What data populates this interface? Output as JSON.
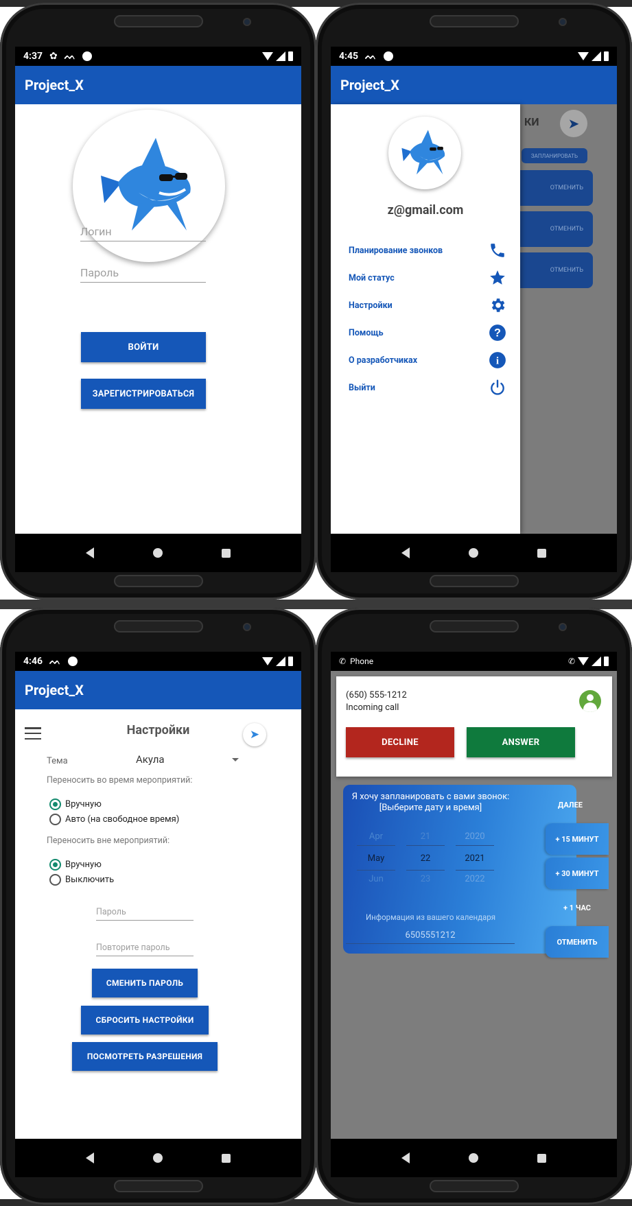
{
  "screens": {
    "login": {
      "time": "4:37",
      "app_title": "Project_X",
      "login_placeholder": "Логин",
      "password_placeholder": "Пароль",
      "login_button": "ВОЙТИ",
      "register_button": "ЗАРЕГИСТРИРОВАТЬСЯ"
    },
    "drawer": {
      "time": "4:45",
      "app_title": "Project_X",
      "email": "z@gmail.com",
      "bg_header_fragment": "КИ",
      "bg_button_schedule": "ЗАПЛАНИРОВАТЬ",
      "bg_button_cancel": "ОТМЕНИТЬ",
      "menu": [
        {
          "label": "Планирование звонков",
          "icon": "phone-icon"
        },
        {
          "label": "Мой статус",
          "icon": "star-icon"
        },
        {
          "label": "Настройки",
          "icon": "gear-icon"
        },
        {
          "label": "Помощь",
          "icon": "help-icon"
        },
        {
          "label": "О разработчиках",
          "icon": "info-icon"
        },
        {
          "label": "Выйти",
          "icon": "power-icon"
        }
      ]
    },
    "settings": {
      "time": "4:46",
      "app_title": "Project_X",
      "page_title": "Настройки",
      "theme_label": "Тема",
      "theme_value": "Акула",
      "during_events_label": "Переносить во время мероприятий:",
      "during_options": [
        "Вручную",
        "Авто (на свободное время)"
      ],
      "during_selected": 0,
      "outside_events_label": "Переносить вне мероприятий:",
      "outside_options": [
        "Вручную",
        "Выключить"
      ],
      "outside_selected": 0,
      "password_placeholder": "Пароль",
      "repeat_password_placeholder": "Повторите пароль",
      "change_password_button": "СМЕНИТЬ ПАРОЛЬ",
      "reset_settings_button": "СБРОСИТЬ НАСТРОЙКИ",
      "view_permissions_button": "ПОСМОТРЕТЬ РАЗРЕШЕНИЯ"
    },
    "call": {
      "status_app": "Phone",
      "caller_number": "(650) 555-1212",
      "call_state": "Incoming call",
      "decline_button": "DECLINE",
      "answer_button": "ANSWER",
      "prompt_line1": "Я хочу запланировать с вами звонок:",
      "prompt_line2": "[Выберите дату и время]",
      "picker": {
        "months": [
          "Apr",
          "May",
          "Jun"
        ],
        "days": [
          "21",
          "22",
          "23"
        ],
        "years": [
          "2020",
          "2021",
          "2022"
        ]
      },
      "calendar_info": "Информация из вашего календаря",
      "phone_input": "6505551212",
      "actions": [
        "ДАЛЕЕ",
        "+ 15 МИНУТ",
        "+ 30 МИНУТ",
        "+ 1 ЧАС",
        "ОТМЕНИТЬ"
      ],
      "colors": {
        "decline": "#b3261e",
        "answer": "#0f7a3d"
      }
    }
  },
  "colors": {
    "primary": "#1557b8",
    "accent": "#148a6e"
  }
}
